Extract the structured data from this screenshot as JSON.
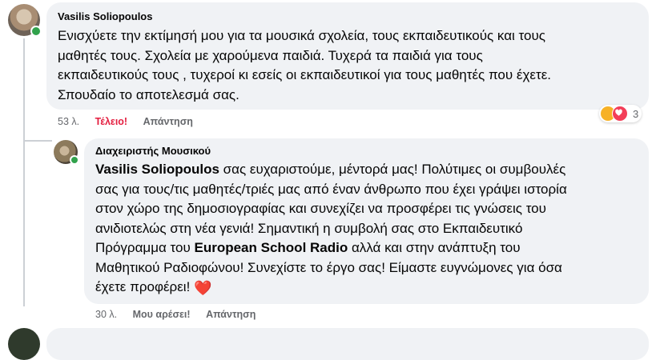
{
  "comment1": {
    "author": "Vasilis Soliopoulos",
    "lines": [
      "Ενισχύετε την εκτίμησή μου για τα μουσικά σχολεία, τους εκπαιδευτικούς και τους",
      "μαθητές τους. Σχολεία με χαρούμενα παιδιά. Τυχερά τα παιδιά για τους",
      "εκπαιδευτικούς τους , τυχεροί κι εσείς οι εκπαιδευτικοί για τους μαθητές που έχετε.",
      "Σπουδαίο το αποτελεσμά σας."
    ],
    "time": "53 λ.",
    "reaction_label": "Τέλειο!",
    "reply_label": "Απάντηση",
    "reaction_count": "3",
    "reaction_icons": [
      "care-icon",
      "love-icon"
    ]
  },
  "reply1": {
    "author": "Διαχειριστής Μουσικού",
    "mention": "Vasilis Soliopoulos",
    "line1_rest": " σας ευχαριστούμε, μέντορά μας! Πολύτιμες οι συμβουλές",
    "lines_mid": [
      "σας για τους/τις μαθητές/τριές μας από έναν άνθρωπο που έχει γράψει ιστορία",
      "στον χώρο της δημοσιογραφίας και συνεχίζει να προσφέρει τις γνώσεις του",
      "ανιδιοτελώς στη νέα γενιά! Σημαντική η συμβολή σας στο Εκπαιδευτικό"
    ],
    "line5_start": "Πρόγραμμα του ",
    "line5_bold": "European School Radio",
    "line5_end": " αλλά και στην ανάπτυξη του",
    "line6": "Μαθητικού Ραδιοφώνου! Συνεχίστε το έργο σας! Είμαστε ευγνώμονες για όσα",
    "line7": "έχετε προφέρει!",
    "emoji": "❤️",
    "time": "30 λ.",
    "like_label": "Μου αρέσει!",
    "reply_label": "Απάντηση"
  },
  "colors": {
    "bubble": "#f0f2f5",
    "meta_text": "#65676b",
    "love_red": "#e41e3f",
    "online_green": "#31a24c"
  }
}
